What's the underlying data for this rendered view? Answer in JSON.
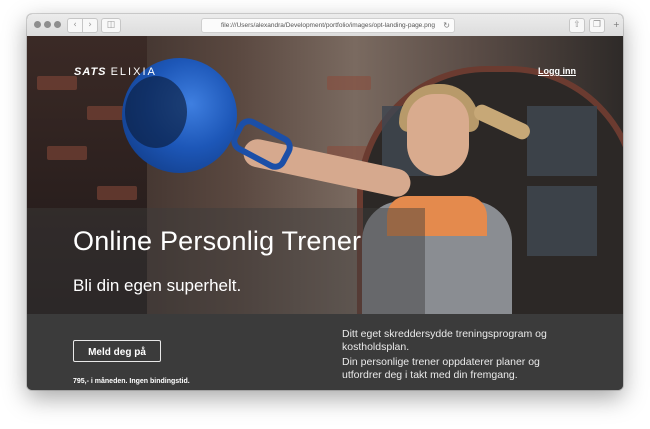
{
  "browser": {
    "url": "file:///Users/alexandra/Development/portfolio/images/opt-landing-page.png",
    "back_icon": "chevron-left-icon",
    "forward_icon": "chevron-right-icon",
    "sidebar_icon": "sidebar-icon",
    "reload_icon": "reload-icon",
    "share_icon": "share-icon",
    "tabs_icon": "tabs-icon",
    "new_tab_icon": "plus-icon"
  },
  "header": {
    "logo_sats": "SATS",
    "logo_elixia": "ELIXIA",
    "login_label": "Logg inn"
  },
  "hero": {
    "title": "Online Personlig Trener",
    "subtitle": "Bli din egen superhelt.",
    "scroll_icon": "chevron-down-icon"
  },
  "signup": {
    "cta_label": "Meld deg på",
    "price_text": "795,- i måneden. Ingen bindingstid."
  },
  "description": {
    "para1": "Ditt eget skreddersydde treningsprogram og kostholdsplan.",
    "para2": "Din personlige trener oppdaterer planer og utfordrer deg i takt med din fremgang."
  },
  "colors": {
    "accent_kettlebell": "#1d57b8",
    "bottom_bg": "#3b3b3b",
    "text": "#ffffff"
  }
}
